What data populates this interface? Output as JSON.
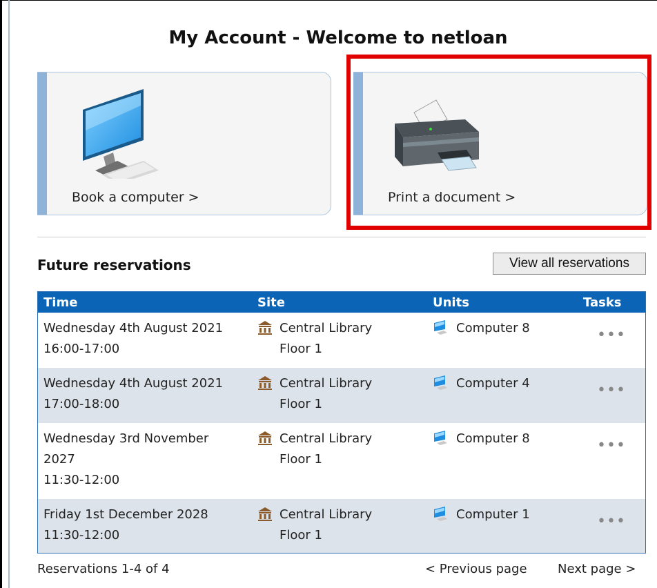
{
  "page": {
    "title": "My Account - Welcome to netloan"
  },
  "tiles": {
    "book": {
      "label": "Book a computer >"
    },
    "print": {
      "label": "Print a document >"
    }
  },
  "reservations": {
    "title": "Future reservations",
    "view_all_label": "View all reservations",
    "columns": {
      "time": "Time",
      "site": "Site",
      "units": "Units",
      "tasks": "Tasks"
    },
    "rows": [
      {
        "time_line1": "Wednesday 4th August 2021",
        "time_line2": "16:00-17:00",
        "time_line3": "",
        "site_line1": "Central Library",
        "site_line2": "Floor 1",
        "unit": "Computer 8",
        "tasks": "•••"
      },
      {
        "time_line1": "Wednesday 4th August 2021",
        "time_line2": "17:00-18:00",
        "time_line3": "",
        "site_line1": "Central Library",
        "site_line2": "Floor 1",
        "unit": "Computer 4",
        "tasks": "•••"
      },
      {
        "time_line1": "Wednesday 3rd November",
        "time_line2": "2027",
        "time_line3": "11:30-12:00",
        "site_line1": "Central Library",
        "site_line2": "Floor 1",
        "unit": "Computer 8",
        "tasks": "•••"
      },
      {
        "time_line1": "Friday 1st December 2028",
        "time_line2": "11:30-12:00",
        "time_line3": "",
        "site_line1": "Central Library",
        "site_line2": "Floor 1",
        "unit": "Computer 1",
        "tasks": "•••"
      }
    ],
    "footer": {
      "count": "Reservations 1-4 of 4",
      "previous": "<  Previous page",
      "next": "Next page  >"
    }
  },
  "colors": {
    "header_blue": "#0b64b5",
    "highlight_red": "#e00000",
    "row_alt": "#dde3ea"
  }
}
